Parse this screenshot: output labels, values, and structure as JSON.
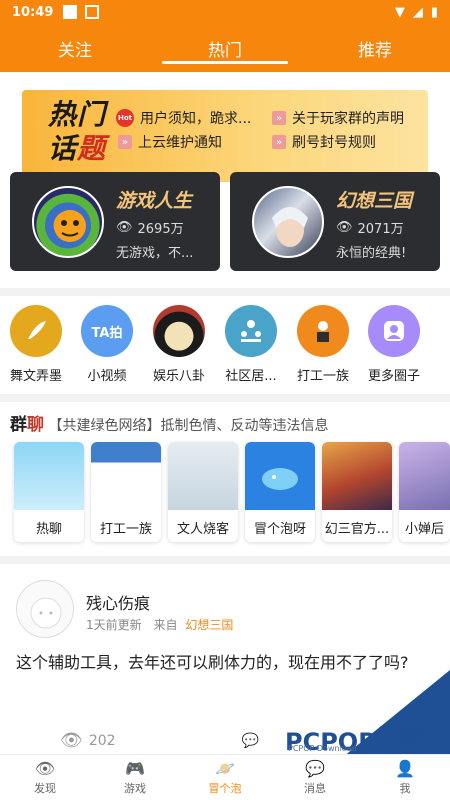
{
  "status_bar": {
    "time": "10:49"
  },
  "top_tabs": [
    {
      "label": "关注",
      "active": false
    },
    {
      "label": "热门",
      "active": true
    },
    {
      "label": "推荐",
      "active": false
    }
  ],
  "hot_topics": {
    "title_line1": "热门",
    "title_line2_a": "话",
    "title_line2_b": "题",
    "badge": "Hot",
    "items": [
      "用户须知，跪求...",
      "关于玩家群的声明",
      "上云维护通知",
      "刷号封号规则"
    ]
  },
  "games": [
    {
      "name": "游戏人生",
      "views": "2695万",
      "desc": "无游戏，不..."
    },
    {
      "name": "幻想三国",
      "views": "2071万",
      "desc": "永恒的经典!"
    }
  ],
  "circles": [
    {
      "label": "舞文弄墨",
      "color": "#e3a81e"
    },
    {
      "label": "小视频",
      "color": "#5b9ef1",
      "icon_text": "TA拍"
    },
    {
      "label": "娱乐八卦",
      "color": "#2d2d2d"
    },
    {
      "label": "社区居...",
      "color": "#4aa3c8"
    },
    {
      "label": "打工一族",
      "color": "#f08a1c"
    },
    {
      "label": "更多圈子",
      "color": "#a78bfa"
    }
  ],
  "group_chat": {
    "title_a": "群",
    "title_b": "聊",
    "subtitle": "【共建绿色网络】抵制色情、反动等违法信息",
    "items": [
      {
        "label": "热聊",
        "color": "#8dd6f5"
      },
      {
        "label": "打工一族",
        "color": "#3f7fcb"
      },
      {
        "label": "文人烧客",
        "color": "#c7d5df"
      },
      {
        "label": "冒个泡呀",
        "color": "#2b82e0"
      },
      {
        "label": "幻三官方...",
        "color": "#b3452e"
      },
      {
        "label": "小婵后",
        "color": "#7a6fb2"
      }
    ]
  },
  "post": {
    "username": "残心伤痕",
    "time": "1天前更新",
    "from_label": "来自",
    "source": "幻想三国",
    "text": "这个辅助工具，去年还可以刷体力的，现在用不了了吗?",
    "views": "202"
  },
  "watermark": {
    "text": "PCPOP下载",
    "sub": "PCPOP Download"
  },
  "bottom_nav": [
    {
      "label": "发现",
      "icon": "eye-icon",
      "active": false
    },
    {
      "label": "游戏",
      "icon": "gamepad-icon",
      "active": false
    },
    {
      "label": "冒个泡",
      "icon": "planet-icon",
      "active": true
    },
    {
      "label": "消息",
      "icon": "chat-icon",
      "active": false
    },
    {
      "label": "我",
      "icon": "user-icon",
      "active": false
    }
  ]
}
